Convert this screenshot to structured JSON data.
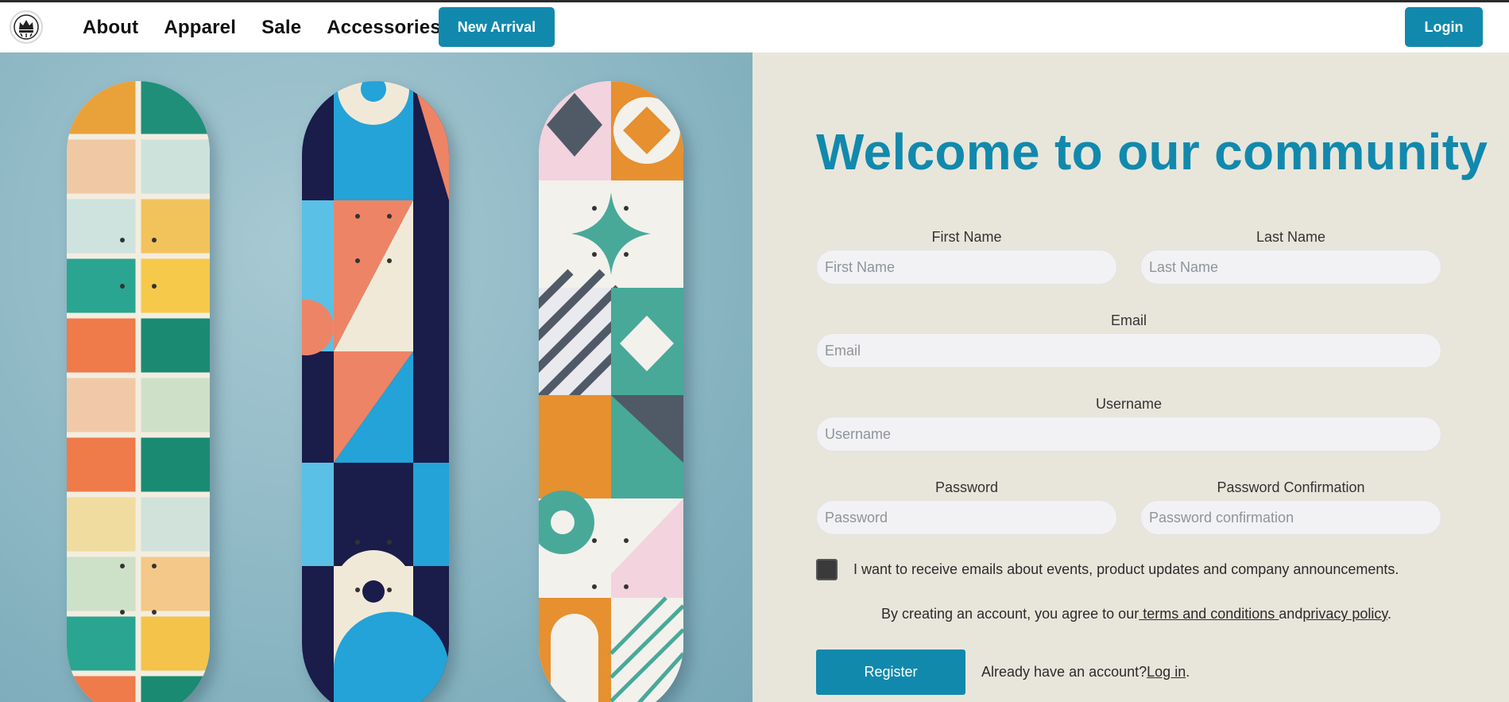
{
  "nav": {
    "logo_icon": "crown-logo-icon",
    "links": [
      "About",
      "Apparel",
      "Sale",
      "Accessories"
    ],
    "new_arrival_label": "New Arrival",
    "login_label": "Login"
  },
  "hero": {
    "image": "three-skateboard-decks-on-blue-wall",
    "colors": {
      "teal": "#1189ad",
      "panel_bg": "#e8e6db"
    }
  },
  "form": {
    "title": "Welcome to our community",
    "first_name": {
      "label": "First Name",
      "placeholder": "First Name"
    },
    "last_name": {
      "label": "Last Name",
      "placeholder": "Last Name"
    },
    "email": {
      "label": "Email",
      "placeholder": "Email"
    },
    "username": {
      "label": "Username",
      "placeholder": "Username"
    },
    "password": {
      "label": "Password",
      "placeholder": "Password"
    },
    "password_confirmation": {
      "label": "Password Confirmation",
      "placeholder": "Password confirmation"
    },
    "emails_opt_in": {
      "label": "I want to receive emails about events, product updates and company announcements.",
      "checked": false
    },
    "agreement": {
      "prefix": "By creating an account, you agree to our",
      "terms_link": " terms and conditions ",
      "middle": "and",
      "privacy_link": "privacy policy",
      "suffix": "."
    },
    "register_label": "Register",
    "already": {
      "text": "Already have an account?",
      "login_link": "Log in",
      "suffix": "."
    }
  }
}
